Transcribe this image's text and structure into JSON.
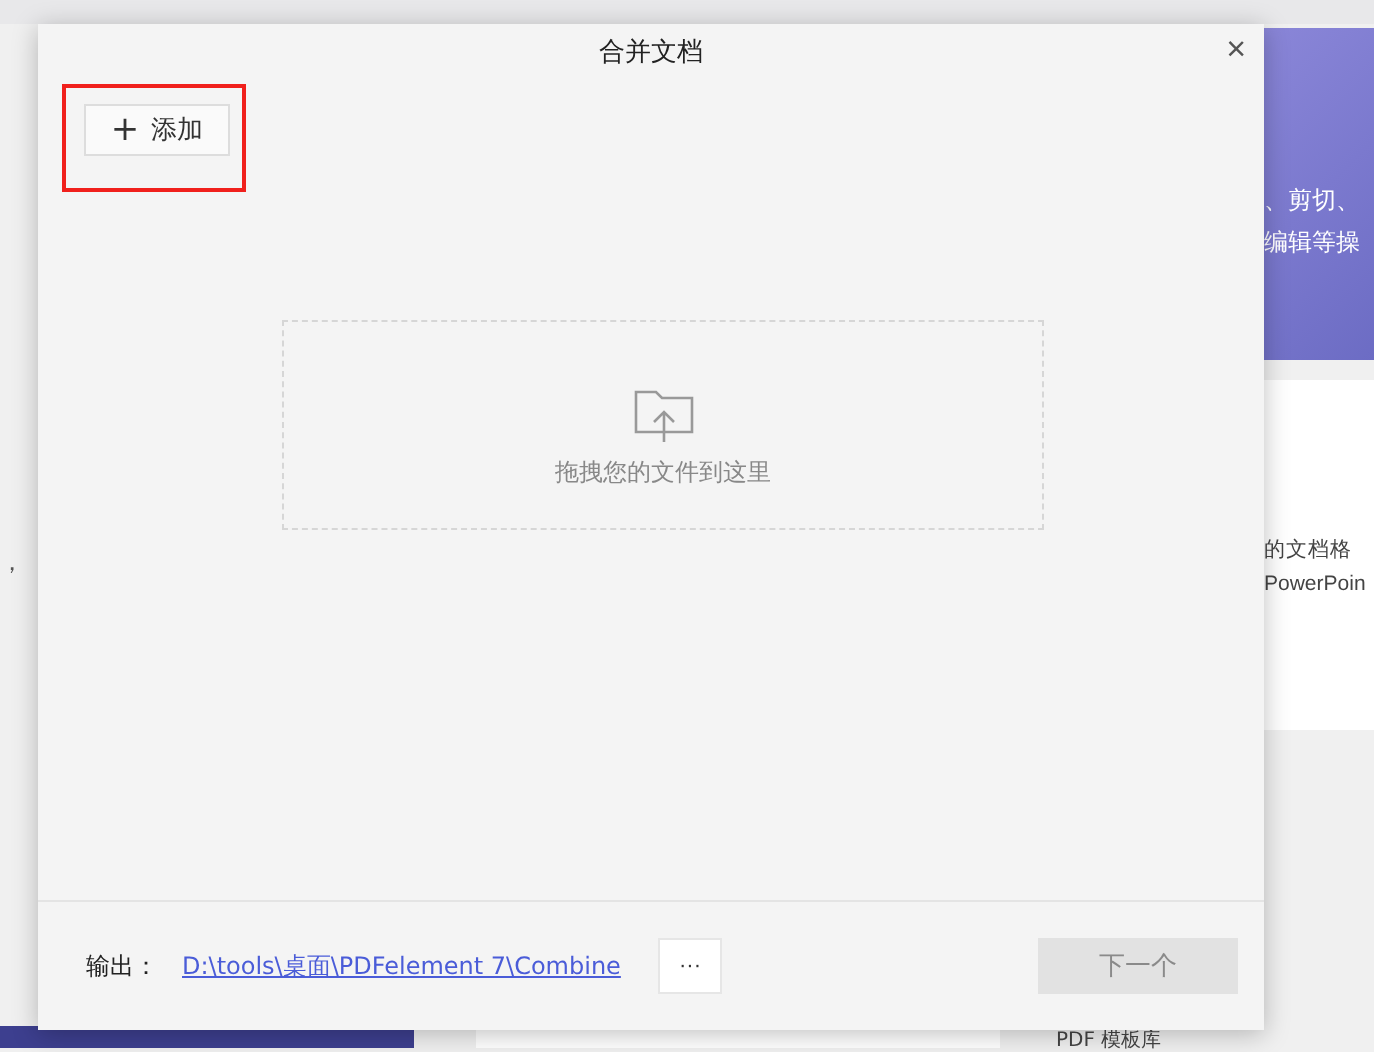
{
  "background": {
    "left_texts": [
      "，"
    ],
    "right_card_texts": [
      "、剪切、",
      "编辑等操"
    ],
    "right_texts": [
      "的文档格",
      "PowerPoin"
    ],
    "bottom_texts": [
      "PDF 模板库"
    ]
  },
  "dialog": {
    "title": "合并文档",
    "close": "×",
    "add_button": {
      "icon": "+",
      "label": "添加",
      "highlighted": true
    },
    "drop_zone": {
      "hint": "拖拽您的文件到这里"
    },
    "output": {
      "label": "输出：",
      "path": "D:\\tools\\桌面\\PDFelement 7\\Combine"
    },
    "browse_button": {
      "label": "···"
    },
    "next_button": {
      "label": "下一个",
      "disabled": true
    }
  }
}
